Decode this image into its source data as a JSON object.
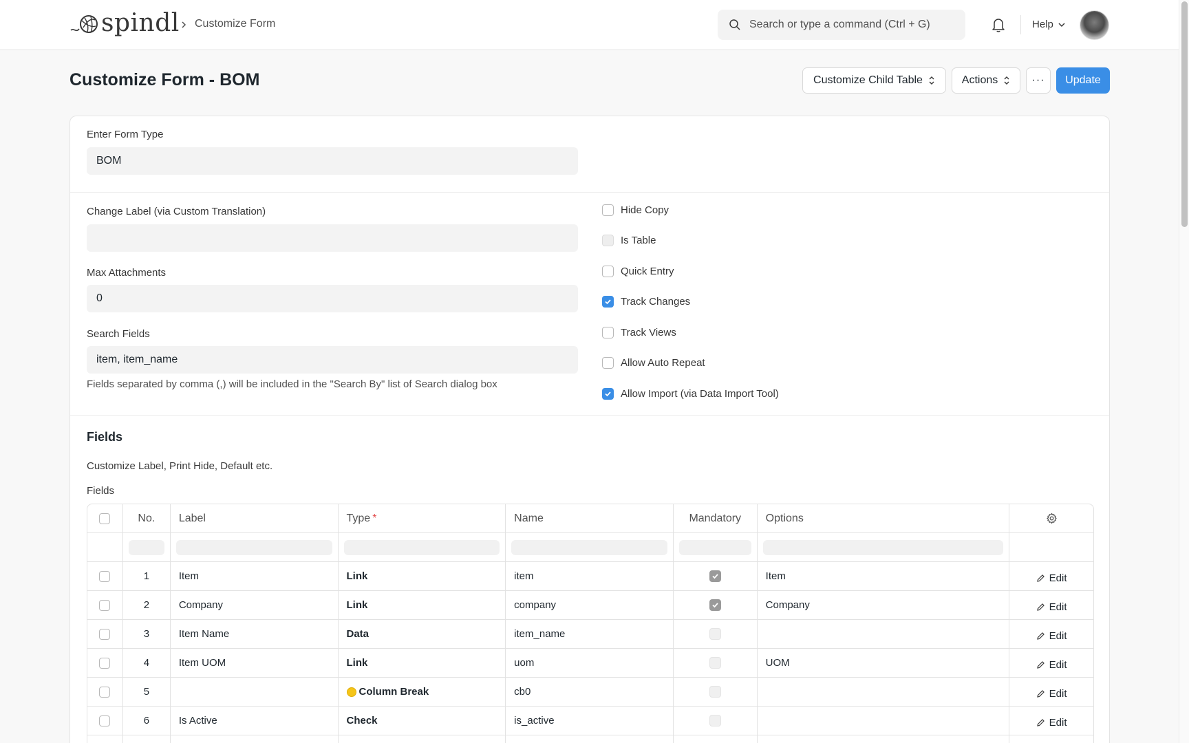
{
  "navbar": {
    "brand": "spindl",
    "breadcrumb": "Customize Form",
    "search_placeholder": "Search or type a command (Ctrl + G)",
    "help_label": "Help"
  },
  "page": {
    "title": "Customize Form - BOM",
    "buttons": {
      "customize_child_table": "Customize Child Table",
      "actions": "Actions",
      "more": "···",
      "update": "Update"
    }
  },
  "form": {
    "form_type_label": "Enter Form Type",
    "form_type_value": "BOM",
    "change_label_label": "Change Label (via Custom Translation)",
    "change_label_value": "",
    "max_attachments_label": "Max Attachments",
    "max_attachments_value": "0",
    "search_fields_label": "Search Fields",
    "search_fields_value": "item, item_name",
    "search_fields_help": "Fields separated by comma (,) will be included in the \"Search By\" list of Search dialog box",
    "checkboxes": [
      {
        "label": "Hide Copy",
        "checked": false,
        "disabled": false
      },
      {
        "label": "Is Table",
        "checked": false,
        "disabled": true
      },
      {
        "label": "Quick Entry",
        "checked": false,
        "disabled": false
      },
      {
        "label": "Track Changes",
        "checked": true,
        "disabled": false
      },
      {
        "label": "Track Views",
        "checked": false,
        "disabled": false
      },
      {
        "label": "Allow Auto Repeat",
        "checked": false,
        "disabled": false
      },
      {
        "label": "Allow Import (via Data Import Tool)",
        "checked": true,
        "disabled": false
      }
    ]
  },
  "fields_section": {
    "title": "Fields",
    "description": "Customize Label, Print Hide, Default etc.",
    "grid_label": "Fields",
    "columns": {
      "no": "No.",
      "label": "Label",
      "type": "Type",
      "type_required_mark": "*",
      "name": "Name",
      "mandatory": "Mandatory",
      "options": "Options"
    },
    "edit_label": "Edit",
    "rows": [
      {
        "no": "1",
        "label": "Item",
        "type": "Link",
        "name": "item",
        "mandatory": true,
        "options": "Item",
        "column_break": false
      },
      {
        "no": "2",
        "label": "Company",
        "type": "Link",
        "name": "company",
        "mandatory": true,
        "options": "Company",
        "column_break": false
      },
      {
        "no": "3",
        "label": "Item Name",
        "type": "Data",
        "name": "item_name",
        "mandatory": false,
        "options": "",
        "column_break": false
      },
      {
        "no": "4",
        "label": "Item UOM",
        "type": "Link",
        "name": "uom",
        "mandatory": false,
        "options": "UOM",
        "column_break": false
      },
      {
        "no": "5",
        "label": "",
        "type": "Column Break",
        "name": "cb0",
        "mandatory": false,
        "options": "",
        "column_break": true
      },
      {
        "no": "6",
        "label": "Is Active",
        "type": "Check",
        "name": "is_active",
        "mandatory": false,
        "options": "",
        "column_break": false
      }
    ]
  },
  "colors": {
    "primary": "#3a8ee6",
    "required": "#e24c4c",
    "column_break_dot": "#f5c518"
  }
}
